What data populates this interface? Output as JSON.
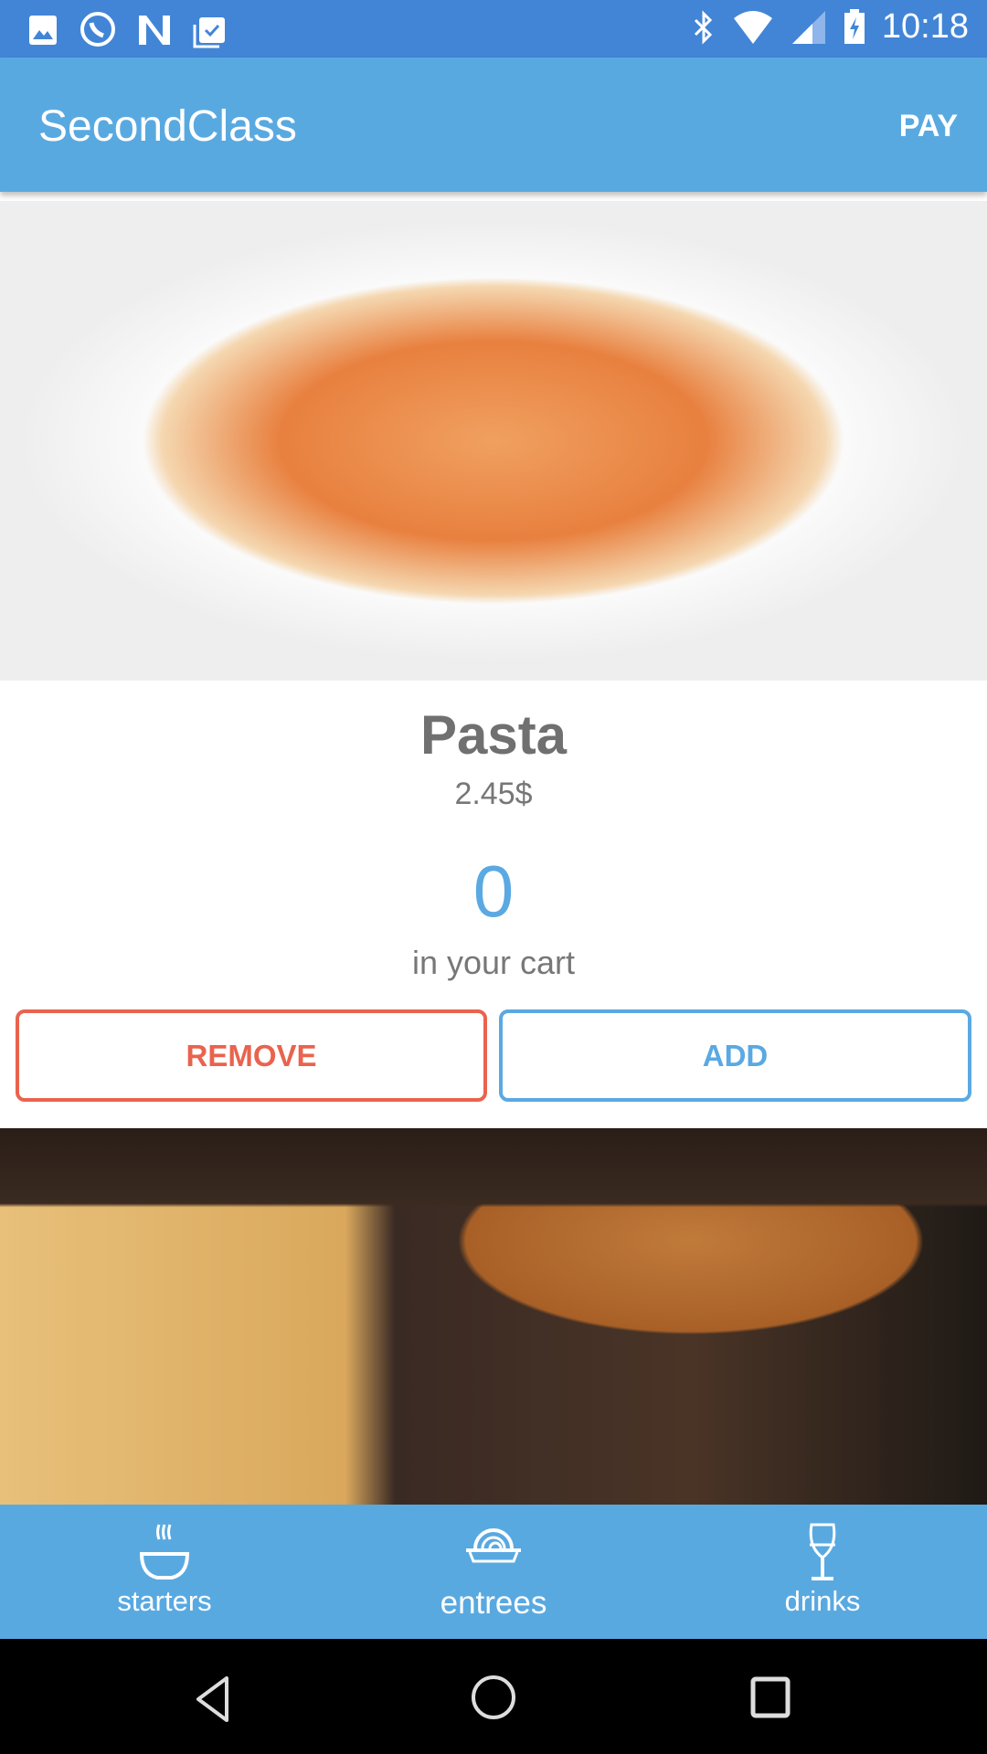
{
  "status_bar": {
    "time": "10:18",
    "left_icons": [
      "gallery-icon",
      "whatsapp-icon",
      "n-icon",
      "clipboard-check-icon"
    ],
    "right_icons": [
      "bluetooth-icon",
      "wifi-icon",
      "signal-icon",
      "battery-charging-icon"
    ]
  },
  "app_bar": {
    "title": "SecondClass",
    "pay_label": "PAY"
  },
  "item": {
    "name": "Pasta",
    "price": "2.45$",
    "count": "0",
    "cart_label": "in your cart",
    "remove_label": "REMOVE",
    "add_label": "ADD"
  },
  "bottom_nav": {
    "tabs": [
      {
        "label": "starters",
        "icon": "soup-bowl-icon"
      },
      {
        "label": "entrees",
        "icon": "pasta-dish-icon"
      },
      {
        "label": "drinks",
        "icon": "wine-glass-icon"
      }
    ],
    "active": "entrees"
  },
  "colors": {
    "status": "#4285d6",
    "primary": "#59a9e1",
    "remove": "#e9634e",
    "add": "#5aa9e2"
  }
}
